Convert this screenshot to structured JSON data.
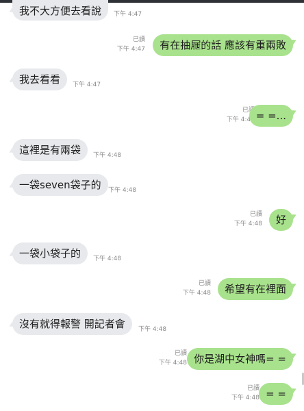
{
  "messages": [
    {
      "dir": "in",
      "text": "我不大方便去看說",
      "time": "下午 4:47"
    },
    {
      "dir": "out",
      "text": "有在抽屜的話 應該有重兩敗",
      "read": "已讀",
      "time": "下午 4:47"
    },
    {
      "dir": "in",
      "text": "我去看看",
      "time": "下午 4:47"
    },
    {
      "dir": "out",
      "text": "= =...",
      "read": "已讀",
      "time": "下午 4:47"
    },
    {
      "dir": "in",
      "text": "這裡是有兩袋",
      "time": "下午 4:48"
    },
    {
      "dir": "in",
      "text": "一袋seven袋子的",
      "time": "下午 4:48"
    },
    {
      "dir": "out",
      "text": "好",
      "read": "已讀",
      "time": "下午 4:48"
    },
    {
      "dir": "in",
      "text": "一袋小袋子的",
      "time": "下午 4:48"
    },
    {
      "dir": "out",
      "text": "希望有在裡面",
      "read": "已讀",
      "time": "下午 4:48"
    },
    {
      "dir": "in",
      "text": "沒有就得報警 開記者會",
      "time": "下午 4:48"
    },
    {
      "dir": "out",
      "text": "你是湖中女神嗎= =",
      "read": "已讀",
      "time": "下午 4:48"
    },
    {
      "dir": "out",
      "text": "= =",
      "read": "已讀",
      "time": "下午 4:48"
    }
  ]
}
